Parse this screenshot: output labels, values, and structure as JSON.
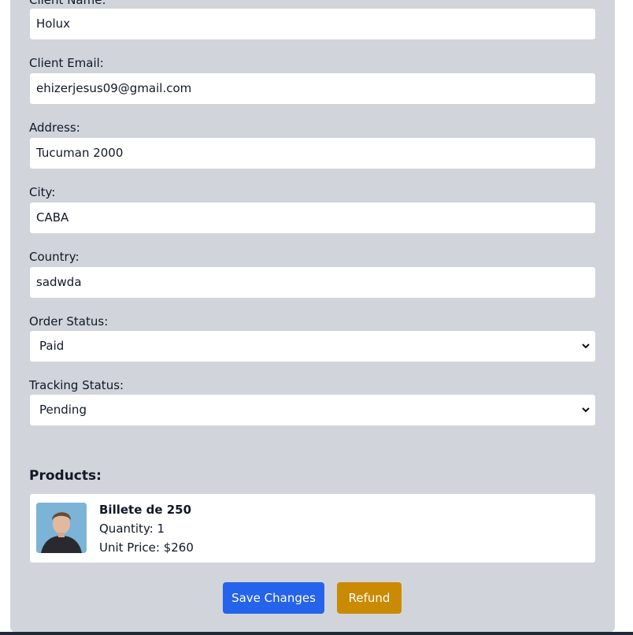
{
  "form": {
    "client_name": {
      "label": "Client Name:",
      "value": "Holux"
    },
    "client_email": {
      "label": "Client Email:",
      "value": "ehizerjesus09@gmail.com"
    },
    "address": {
      "label": "Address:",
      "value": "Tucuman 2000"
    },
    "city": {
      "label": "City:",
      "value": "CABA"
    },
    "country": {
      "label": "Country:",
      "value": "sadwda"
    },
    "order_status": {
      "label": "Order Status:",
      "selected": "Paid"
    },
    "tracking_status": {
      "label": "Tracking Status:",
      "selected": "Pending"
    }
  },
  "products": {
    "heading": "Products:",
    "items": [
      {
        "name": "Billete de 250",
        "quantity": "Quantity: 1",
        "unit_price": "Unit Price: $260"
      }
    ]
  },
  "actions": {
    "save_label": "Save Changes",
    "refund_label": "Refund"
  },
  "colors": {
    "panel": "#d1d5db",
    "save": "#2563eb",
    "refund": "#ca8a04"
  }
}
